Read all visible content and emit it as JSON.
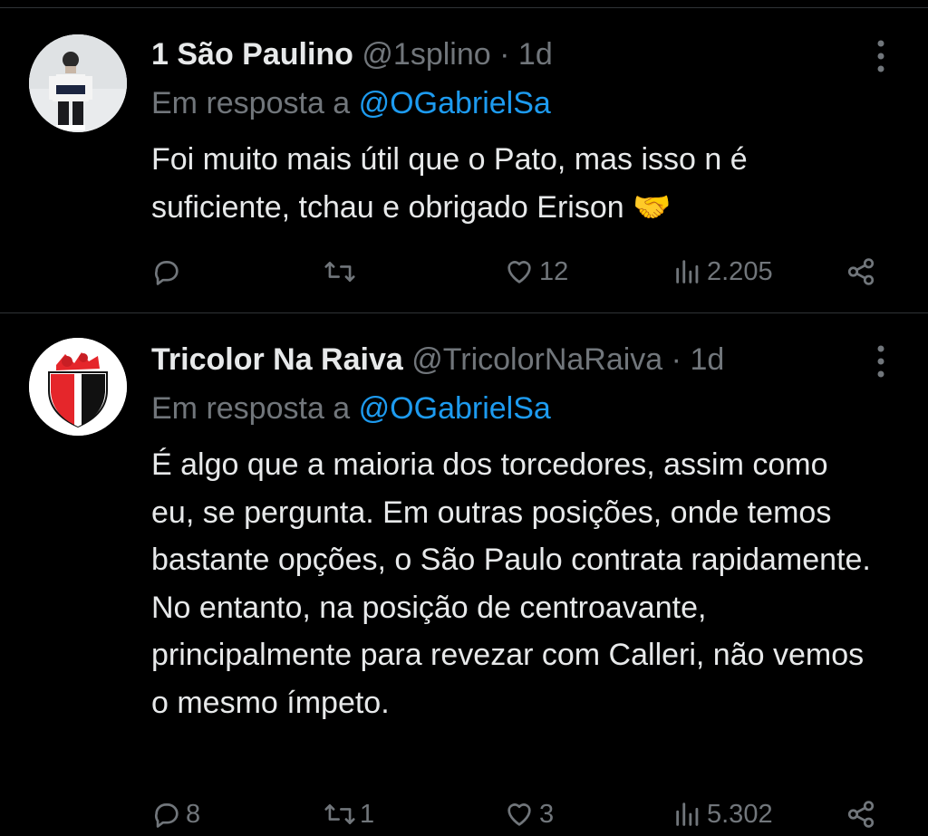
{
  "tweets": [
    {
      "display_name": "1 São Paulino",
      "handle": "@1splino",
      "separator": "·",
      "time": "1d",
      "reply_prefix": "Em resposta a",
      "reply_to": "@OGabrielSa",
      "text": "Foi muito mais útil que o Pato, mas isso n é suficiente, tchau e obrigado Erison 🤝",
      "actions": {
        "replies": "",
        "retweets": "",
        "likes": "12",
        "views": "2.205"
      },
      "icons": [
        "reply-icon",
        "retweet-icon",
        "heart-icon",
        "views-icon",
        "share-icon",
        "more-icon"
      ]
    },
    {
      "display_name": "Tricolor Na Raiva",
      "handle": "@TricolorNaRaiva",
      "separator": "·",
      "time": "1d",
      "reply_prefix": "Em resposta a",
      "reply_to": "@OGabrielSa",
      "text": "É algo que a maioria dos torcedores, assim como eu, se pergunta. Em outras posições, onde temos bastante opções, o São Paulo contrata rapidamente. No entanto, na posição de centroavante, principalmente para revezar com Calleri, não vemos o mesmo ímpeto.",
      "actions": {
        "replies": "8",
        "retweets": "1",
        "likes": "3",
        "views": "5.302"
      },
      "icons": [
        "reply-icon",
        "retweet-icon",
        "heart-icon",
        "views-icon",
        "share-icon",
        "more-icon"
      ]
    }
  ],
  "colors": {
    "background": "#000000",
    "text_primary": "#e7e9ea",
    "text_secondary": "#71767b",
    "link": "#1d9bf0",
    "divider": "#2f3336"
  }
}
